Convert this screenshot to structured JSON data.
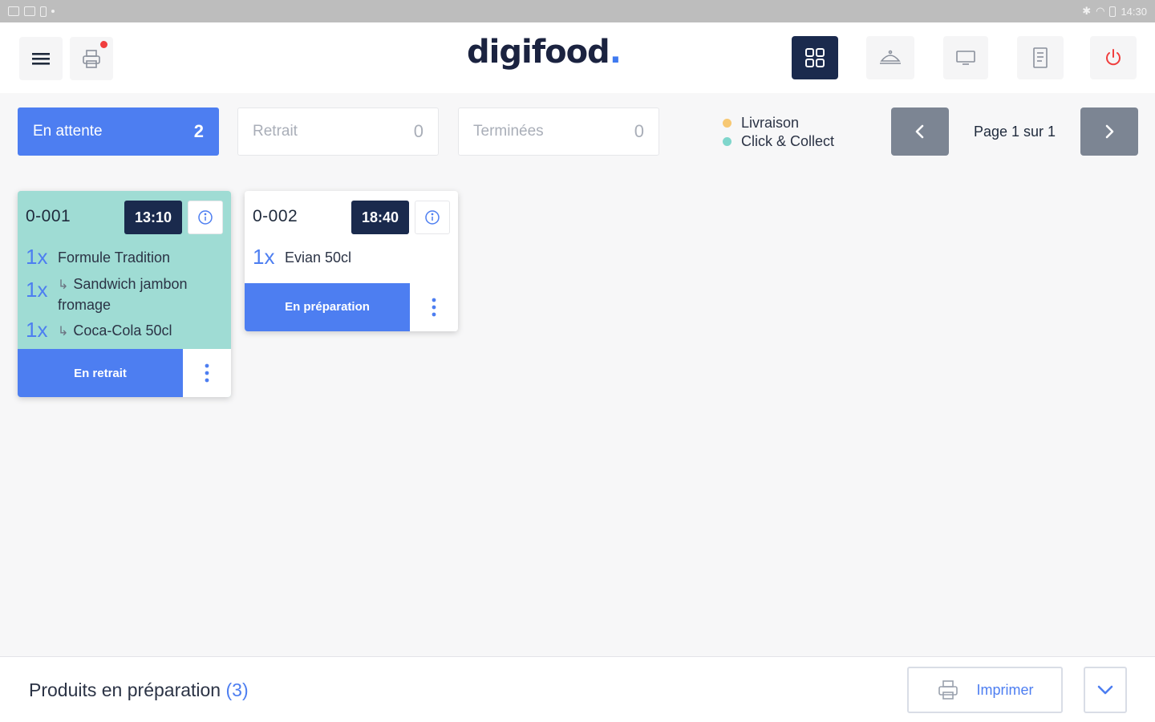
{
  "status_bar": {
    "time": "14:30"
  },
  "header": {
    "logo_text": "digifood",
    "logo_dot": ".",
    "menu_icon": "hamburger-menu-icon",
    "printer_icon": "printer-icon",
    "nav": [
      {
        "name": "grid-view-icon",
        "active": true
      },
      {
        "name": "delivery-icon",
        "active": false
      },
      {
        "name": "display-icon",
        "active": false
      },
      {
        "name": "receipt-icon",
        "active": false
      },
      {
        "name": "power-icon",
        "active": false
      }
    ]
  },
  "tabs": [
    {
      "label": "En attente",
      "count": "2",
      "active": true
    },
    {
      "label": "Retrait",
      "count": "0",
      "active": false
    },
    {
      "label": "Terminées",
      "count": "0",
      "active": false
    }
  ],
  "legend": [
    {
      "label": "Livraison",
      "color": "#f7c873"
    },
    {
      "label": "Click & Collect",
      "color": "#7fd6cc"
    }
  ],
  "pager": {
    "text": "Page 1 sur 1"
  },
  "orders": [
    {
      "number": "0-001",
      "time": "13:10",
      "color": "#9fdcd4",
      "items": [
        {
          "qty": "1x",
          "sub_marker": "",
          "name": "Formule Tradition"
        },
        {
          "qty": "1x",
          "sub_marker": "↳",
          "name": "Sandwich jambon fromage"
        },
        {
          "qty": "1x",
          "sub_marker": "↳",
          "name": "Coca-Cola 50cl"
        }
      ],
      "action_label": "En retrait"
    },
    {
      "number": "0-002",
      "time": "18:40",
      "color": "#ffffff",
      "items": [
        {
          "qty": "1x",
          "sub_marker": "",
          "name": "Evian 50cl"
        }
      ],
      "action_label": "En préparation"
    }
  ],
  "bottom_bar": {
    "title": "Produits en préparation",
    "count": "(3)",
    "print_label": "Imprimer"
  },
  "colors": {
    "accent": "#4d7ef1",
    "navy": "#1a2a4d",
    "power_red": "#f03e3e"
  }
}
